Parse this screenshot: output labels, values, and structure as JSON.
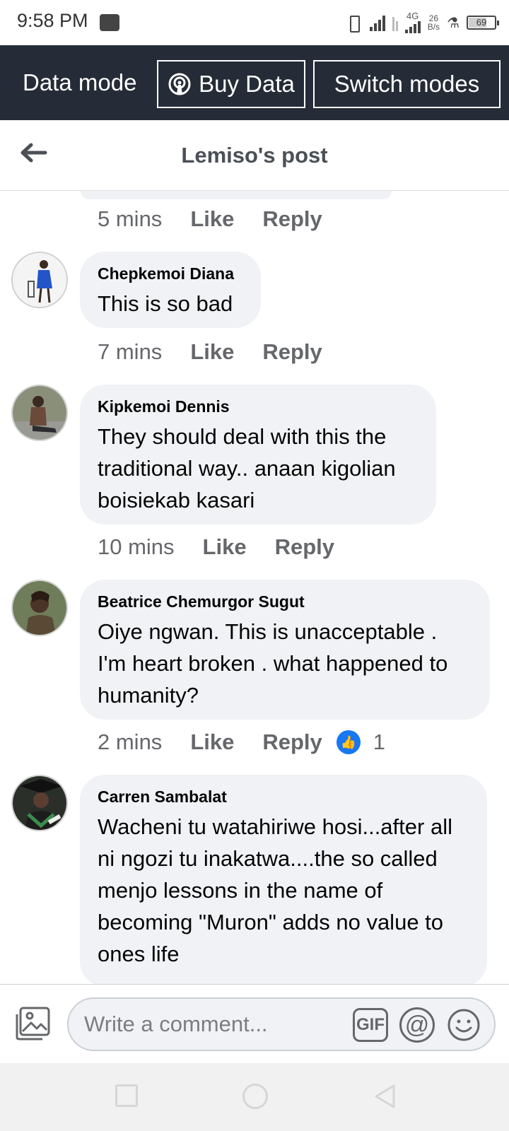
{
  "status_bar": {
    "time": "9:58 PM",
    "network_type": "4G",
    "speed_value": "26",
    "speed_unit": "B/s",
    "battery": "69",
    "battery_level": 0.69
  },
  "data_bar": {
    "mode_label": "Data mode",
    "buy_label": "Buy Data",
    "switch_label": "Switch modes",
    "background": "#252c37"
  },
  "header": {
    "title": "Lemiso's post"
  },
  "previous_comment_meta": {
    "time": "5 mins",
    "like": "Like",
    "reply": "Reply"
  },
  "comments": [
    {
      "author": "Chepkemoi Diana",
      "text": "This is so bad",
      "time": "7 mins",
      "like": "Like",
      "reply": "Reply"
    },
    {
      "author": "Kipkemoi Dennis",
      "text": "They should deal with this the traditional way.. anaan kigolian boisiekab kasari",
      "time": "10 mins",
      "like": "Like",
      "reply": "Reply"
    },
    {
      "author": "Beatrice Chemurgor Sugut",
      "text": "Oiye  ngwan. This is unacceptable . I'm heart broken . what happened to humanity?",
      "time": "2 mins",
      "like": "Like",
      "reply": "Reply",
      "reaction_count": "1",
      "reaction_icon": "like-thumb-icon"
    },
    {
      "author": "Carren Sambalat",
      "text": "Wacheni tu watahiriwe hosi...after all ni ngozi tu inakatwa....the so called menjo lessons in the name of becoming \"Muron\" adds no value to ones life"
    }
  ],
  "composer": {
    "placeholder": "Write a comment...",
    "gif_label": "GIF",
    "at_label": "@"
  },
  "colors": {
    "bubble": "#f0f2f5",
    "meta_text": "#65676b",
    "reaction_blue": "#1877f2"
  }
}
